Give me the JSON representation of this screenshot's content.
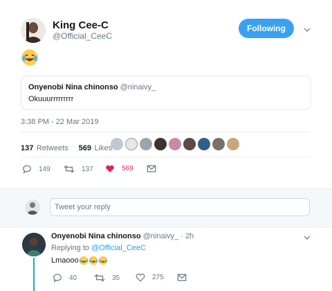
{
  "tweet": {
    "author_name": "King Cee-C",
    "author_handle": "@Official_CeeC",
    "follow_label": "Following",
    "body_emoji": "laughing-with-tears",
    "timestamp": "3:38 PM - 22 Mar 2019",
    "retweets_count": "137",
    "retweets_label": "Retweets",
    "likes_count": "569",
    "likes_label": "Likes",
    "quoted": {
      "author_name": "Onyenobi Nina chinonso",
      "author_handle": "@ninaivy_",
      "text": "Okuuurrrrrrrrr"
    },
    "actions": {
      "reply_count": "149",
      "retweet_count": "137",
      "like_count": "569"
    }
  },
  "reply_composer": {
    "placeholder": "Tweet your reply"
  },
  "reply": {
    "author_name": "Onyenobi Nina chinonso",
    "author_handle": "@ninaivy_",
    "time": "· 2h",
    "replying_to_label": "Replying to",
    "replying_to_handle": "@Official_CeeC",
    "text": "Lmaooo",
    "actions": {
      "reply_count": "40",
      "retweet_count": "35",
      "like_count": "275"
    }
  },
  "colors": {
    "accent": "#1da1f2",
    "like": "#e0245e",
    "muted": "#657786",
    "border": "#e6ecf0"
  }
}
